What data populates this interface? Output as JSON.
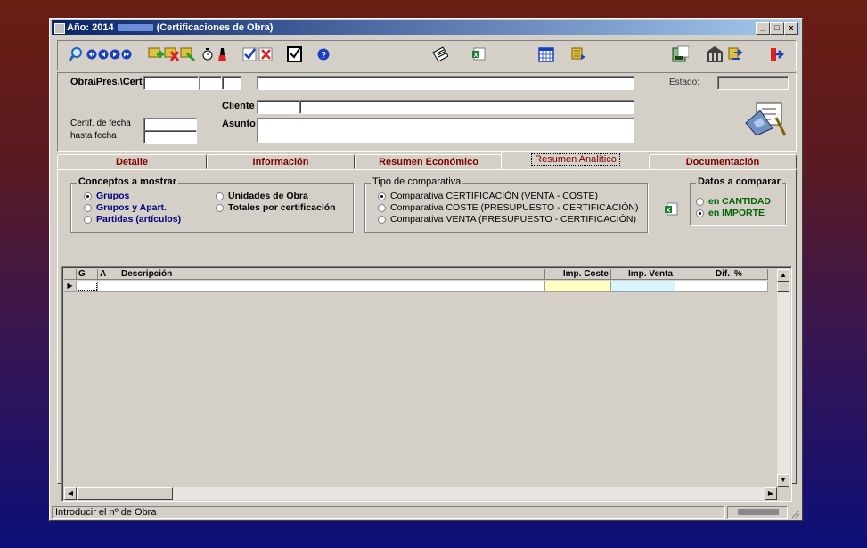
{
  "window": {
    "title_prefix": "Año: 2014",
    "title_suffix": "(Certificaciones de Obra)",
    "minimize": "_",
    "maximize": "□",
    "close": "x"
  },
  "toolbar": {
    "icons": [
      "search-icon",
      "first-record-icon",
      "previous-record-icon",
      "next-record-icon",
      "last-record-icon",
      "add-record-icon",
      "delete-record-icon",
      "edit-record-icon",
      "timer-icon",
      "pen-icon",
      "accept-icon",
      "cancel-icon",
      "checklist-icon",
      "help-icon",
      "document-icon",
      "excel-icon",
      "calendar-icon",
      "print-icon",
      "calculator-icon",
      "building-icon",
      "transfer-icon",
      "exit-icon"
    ]
  },
  "form": {
    "obra_label": "Obra\\Pres.\\Cert.",
    "estado_label": "Estado:",
    "cliente_label": "Cliente",
    "asunto_label": "Asunto",
    "certif_fecha_label": "Certif. de fecha",
    "hasta_fecha_label": "hasta fecha"
  },
  "tabs": [
    {
      "label": "Detalle"
    },
    {
      "label": "Información"
    },
    {
      "label": "Resumen Económico"
    },
    {
      "label": "Resumen Analítico"
    },
    {
      "label": "Documentación"
    }
  ],
  "conceptos": {
    "title": "Conceptos a mostrar",
    "options": [
      "Grupos",
      "Grupos y Apart.",
      "Partidas (artículos)",
      "Unidades de Obra",
      "Totales por certificación"
    ]
  },
  "comparativa": {
    "title": "Tipo de comparativa",
    "options": [
      "Comparativa CERTIFICACIÓN  (VENTA - COSTE)",
      "Comparativa COSTE (PRESUPUESTO - CERTIFICACIÓN)",
      "Comparativa VENTA (PRESUPUESTO - CERTIFICACIÓN)"
    ]
  },
  "datos": {
    "title": "Datos a comparar",
    "options": [
      "en CANTIDAD",
      "en IMPORTE"
    ]
  },
  "grid": {
    "columns": [
      "G",
      "A",
      "Descripción",
      "Imp. Coste",
      "Imp. Venta",
      "Dif.",
      "%"
    ],
    "row_indicator": "▶"
  },
  "status": {
    "message": "Introducir el nº de Obra"
  },
  "colors": {
    "cost_column": "#ffffc0",
    "sale_column": "#d8f4ff",
    "tab_text": "#800000",
    "navy_text": "#000080",
    "green_text": "#006400"
  }
}
